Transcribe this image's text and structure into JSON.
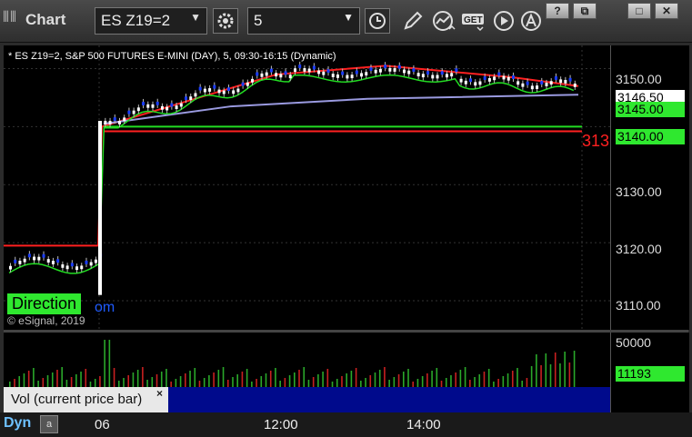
{
  "app": {
    "title": "Chart"
  },
  "toolbar": {
    "symbol": "ES Z19=2",
    "interval": "5",
    "icons": [
      "settings-gear-icon",
      "clock-icon",
      "pencil-icon",
      "study-icon",
      "get-icon",
      "play-icon",
      "alert-icon"
    ],
    "window_buttons": [
      "?",
      "⧉",
      "□",
      "✕"
    ],
    "get_label": "GET"
  },
  "chart": {
    "header": "* ES Z19=2, S&P 500 FUTURES E-MINI (DAY), 5, 09:30-16:15 (Dynamic)",
    "price_ticks": [
      "3150.00",
      "3130.00",
      "3120.00",
      "3110.00"
    ],
    "price_last": "3146.50",
    "price_ma": "3145.00",
    "price_level": "3140.00",
    "partial_red_label": "313",
    "direction_label": "Direction",
    "watermark_fragment": "om",
    "copyright": "© eSignal, 2019",
    "ylim": [
      3105,
      3154
    ],
    "colors": {
      "up": "#ffffff",
      "down": "#1a3cff",
      "ma_fast": "#22dd22",
      "ma_slow": "#9a9ae0",
      "resistance": "#ff2020",
      "support": "#22dd22"
    }
  },
  "volume": {
    "tick_top": "50000",
    "current": "11193",
    "study_label": "Vol (current price bar)",
    "close_label": "×"
  },
  "timeaxis": {
    "mode": "Dyn",
    "lock_icon": "a",
    "labels": [
      "06",
      "12:00",
      "14:00"
    ]
  }
}
